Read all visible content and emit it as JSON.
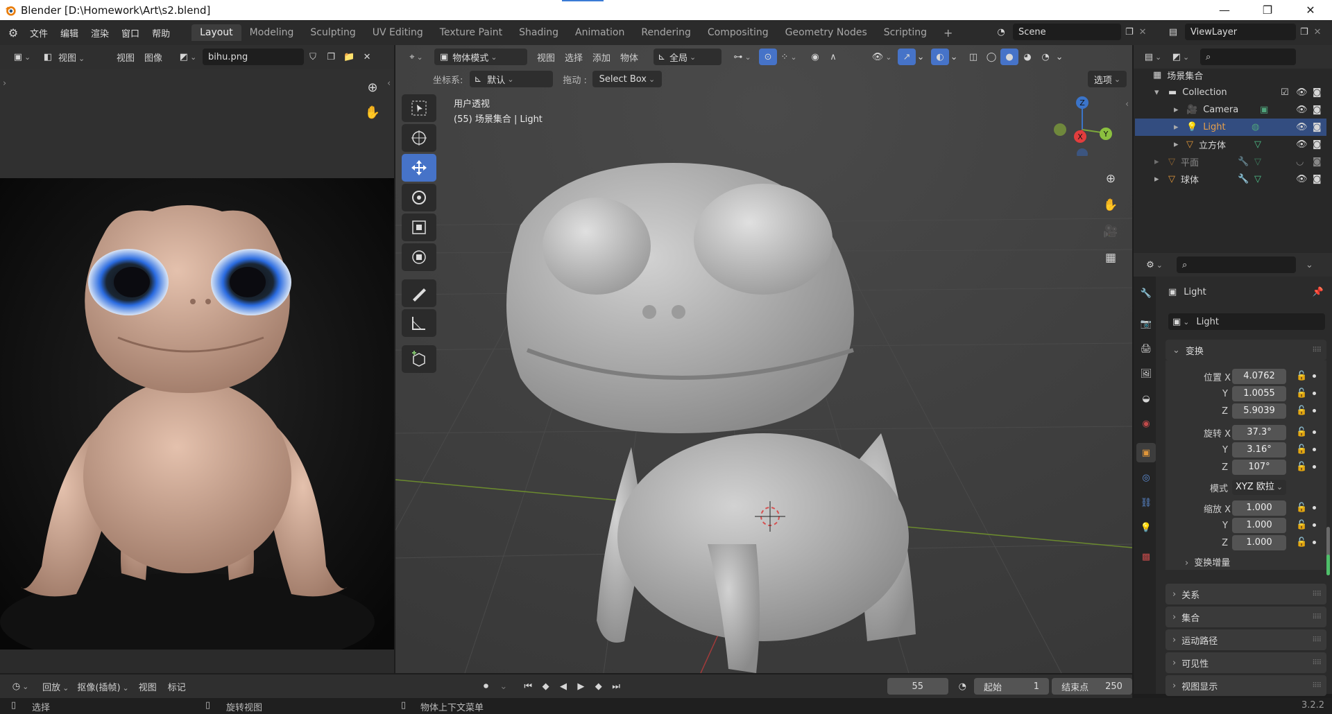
{
  "window": {
    "title": "Blender [D:\\Homework\\Art\\s2.blend]"
  },
  "menu": [
    "文件",
    "编辑",
    "渲染",
    "窗口",
    "帮助"
  ],
  "workspaces": [
    "Layout",
    "Modeling",
    "Sculpting",
    "UV Editing",
    "Texture Paint",
    "Shading",
    "Animation",
    "Rendering",
    "Compositing",
    "Geometry Nodes",
    "Scripting"
  ],
  "active_workspace": "Layout",
  "scene": {
    "label": "Scene",
    "viewlayer": "ViewLayer",
    "add": "+"
  },
  "image_editor": {
    "view_mode": "视图",
    "menu_view": "视图",
    "menu_image": "图像",
    "image_name": "bihu.png"
  },
  "viewport": {
    "mode": "物体模式",
    "menu": [
      "视图",
      "选择",
      "添加",
      "物体"
    ],
    "transform_orient": "全局",
    "coord_label": "坐标系:",
    "coord_value": "默认",
    "drag_label": "拖动 :",
    "drag_value": "Select Box",
    "options": "选项",
    "overlay_title": "用户透视",
    "overlay_sub": "(55) 场景集合 | Light",
    "gizmo": {
      "x": "X",
      "y": "Y",
      "z": "Z"
    }
  },
  "outliner": {
    "root": "场景集合",
    "items": [
      {
        "name": "Collection",
        "level": 1,
        "type": "collection"
      },
      {
        "name": "Camera",
        "level": 2,
        "type": "camera"
      },
      {
        "name": "Light",
        "level": 2,
        "type": "light",
        "selected": true
      },
      {
        "name": "立方体",
        "level": 2,
        "type": "mesh"
      },
      {
        "name": "平面",
        "level": 1,
        "type": "mesh",
        "hidden": true
      },
      {
        "name": "球体",
        "level": 1,
        "type": "mesh"
      }
    ]
  },
  "properties": {
    "object_name": "Light",
    "data_name": "Light",
    "transform_header": "变换",
    "location": {
      "label": "位置",
      "x": "4.0762",
      "y": "1.0055",
      "z": "5.9039"
    },
    "rotation": {
      "label": "旋转",
      "x": "37.3°",
      "y": "3.16°",
      "z": "107°"
    },
    "mode_label": "模式",
    "mode_value": "XYZ 欧拉",
    "scale": {
      "label": "缩放",
      "x": "1.000",
      "y": "1.000",
      "z": "1.000"
    },
    "axis": {
      "x": "X",
      "y": "Y",
      "z": "Z"
    },
    "delta": "变换增量",
    "sections": [
      "关系",
      "集合",
      "运动路径",
      "可见性",
      "视图显示"
    ]
  },
  "timeline": {
    "playback": "回放",
    "keying": "抠像(插帧)",
    "view": "视图",
    "marker": "标记",
    "current_frame": "55",
    "start_label": "起始",
    "start": "1",
    "end_label": "结束点",
    "end": "250"
  },
  "status": {
    "select": "选择",
    "rotate": "旋转视图",
    "context": "物体上下文菜单",
    "version": "3.2.2"
  },
  "colors": {
    "accent": "#4673c8",
    "selected_row": "#334d80",
    "header": "#2f2f2f",
    "viewport_bg": "#3d3d3d"
  }
}
